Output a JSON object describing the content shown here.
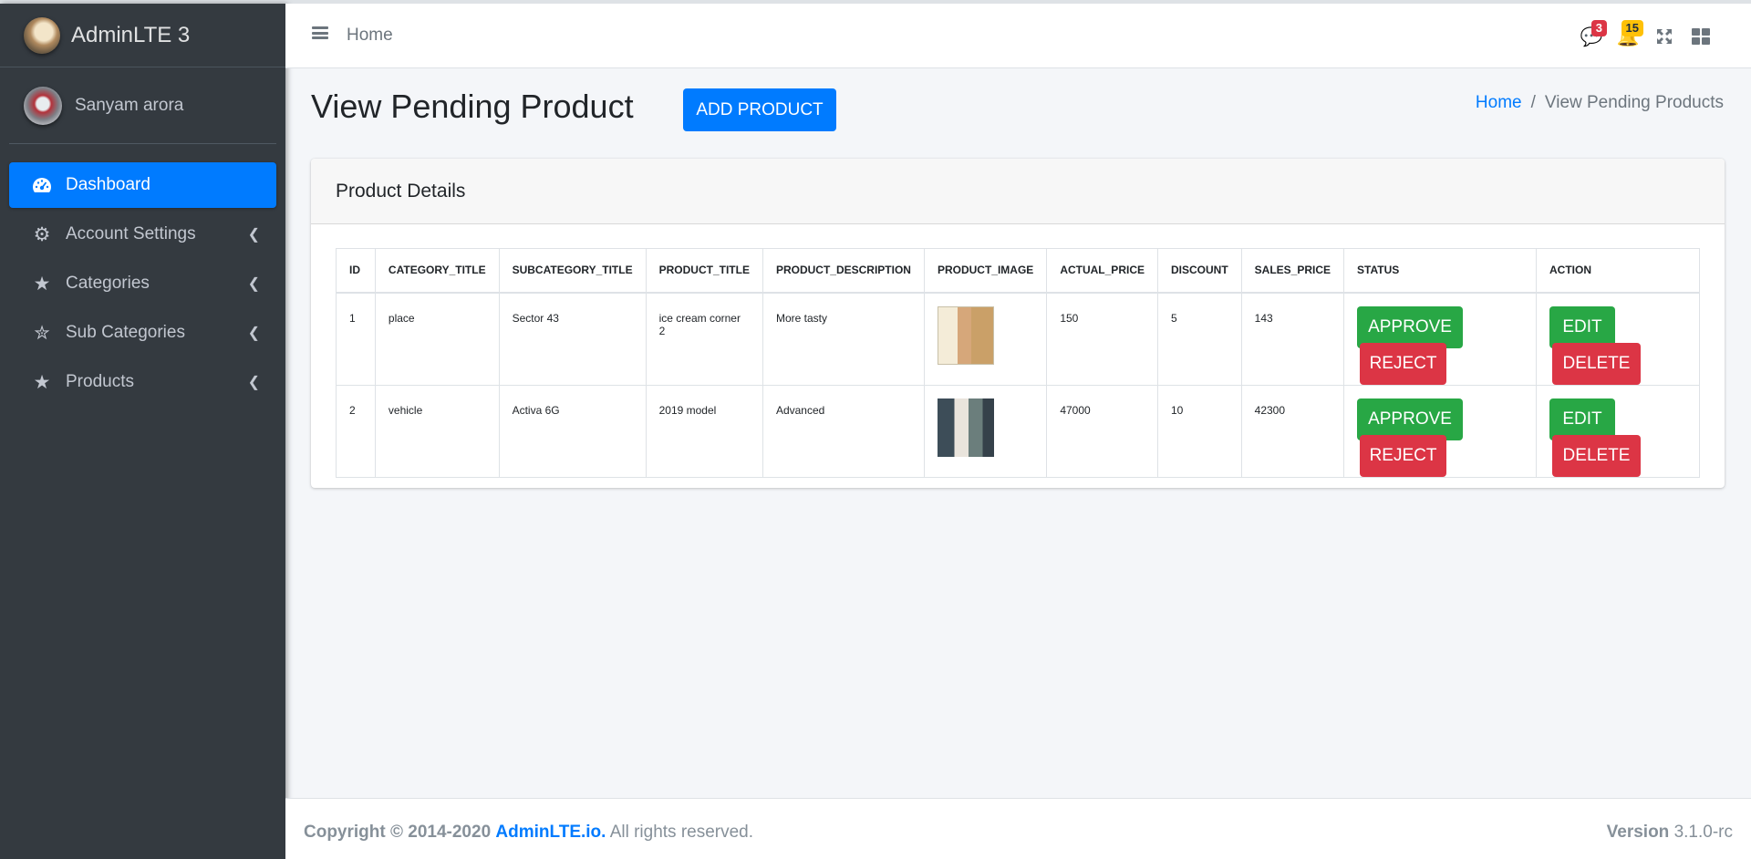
{
  "brand": {
    "title": "AdminLTE 3",
    "logo_icon": "adminlte-logo"
  },
  "user": {
    "name": "Sanyam arora",
    "avatar_icon": "user-avatar"
  },
  "sidebar": {
    "items": [
      {
        "label": "Dashboard",
        "icon": "tachometer-icon",
        "active": true
      },
      {
        "label": "Account Settings",
        "icon": "gear-icon"
      },
      {
        "label": "Categories",
        "icon": "star-icon"
      },
      {
        "label": "Sub Categories",
        "icon": "star-half-icon"
      },
      {
        "label": "Products",
        "icon": "star-icon"
      }
    ]
  },
  "navbar": {
    "home": "Home",
    "messages_count": "3",
    "notifications_count": "15"
  },
  "header": {
    "title": "View Pending Product",
    "add_button": "ADD PRODUCT",
    "breadcrumb": {
      "home": "Home",
      "separator": "/",
      "current": "View Pending Products"
    }
  },
  "card": {
    "title": "Product Details",
    "columns": [
      "ID",
      "CATEGORY_TITLE",
      "SUBCATEGORY_TITLE",
      "PRODUCT_TITLE",
      "PRODUCT_DESCRIPTION",
      "PRODUCT_IMAGE",
      "ACTUAL_PRICE",
      "DISCOUNT",
      "SALES_PRICE",
      "STATUS",
      "ACTION"
    ],
    "rows": [
      {
        "id": "1",
        "category": "place",
        "subcategory": "Sector 43",
        "title": "ice cream corner 2",
        "description": "More tasty",
        "actual_price": "150",
        "discount": "5",
        "sales_price": "143"
      },
      {
        "id": "2",
        "category": "vehicle",
        "subcategory": "Activa 6G",
        "title": "2019 model",
        "description": "Advanced",
        "actual_price": "47000",
        "discount": "10",
        "sales_price": "42300"
      }
    ],
    "buttons": {
      "approve": "APPROVE",
      "reject": "REJECT",
      "edit": "EDIT",
      "delete": "DELETE"
    }
  },
  "footer": {
    "copyright": "Copyright © 2014-2020",
    "link": "AdminLTE.io.",
    "rights": "All rights reserved.",
    "version_label": "Version",
    "version": "3.1.0-rc"
  },
  "colors": {
    "primary": "#007bff",
    "success": "#28a745",
    "danger": "#dc3545",
    "warning": "#ffc107",
    "sidebar": "#343a40"
  }
}
